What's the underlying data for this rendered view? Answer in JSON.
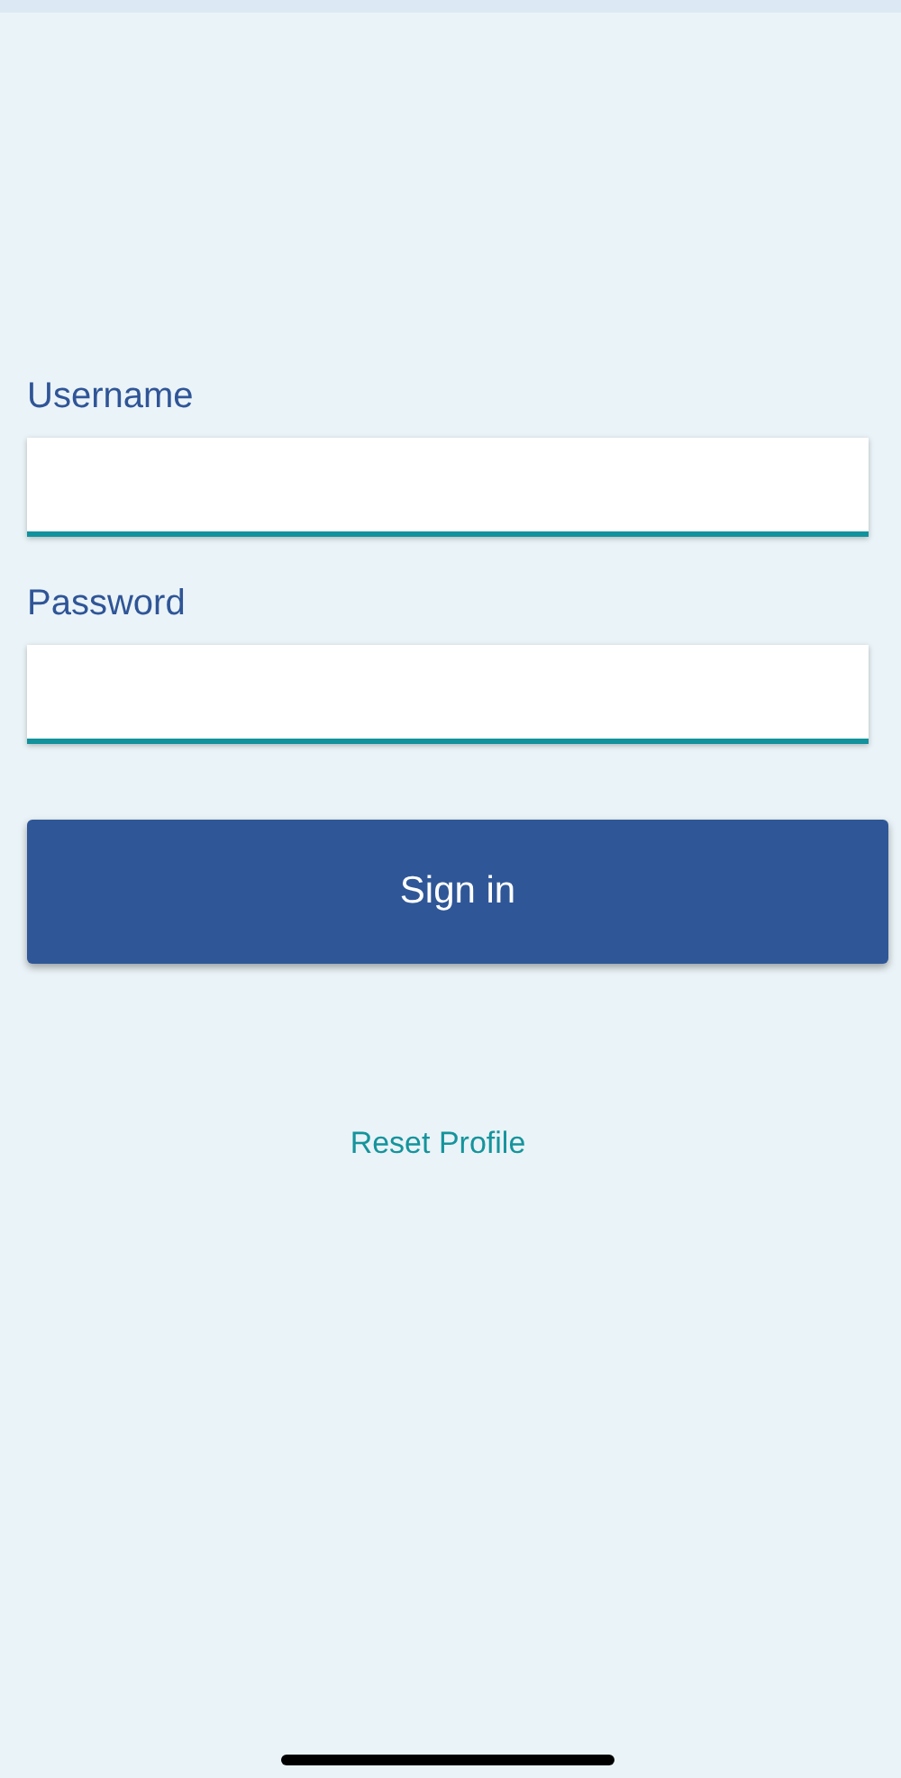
{
  "fields": [
    {
      "label": "Username"
    },
    {
      "label": "Password"
    }
  ],
  "sign_in_button": {
    "label": "Sign in"
  },
  "reset_link": {
    "label": "Reset Profile"
  }
}
